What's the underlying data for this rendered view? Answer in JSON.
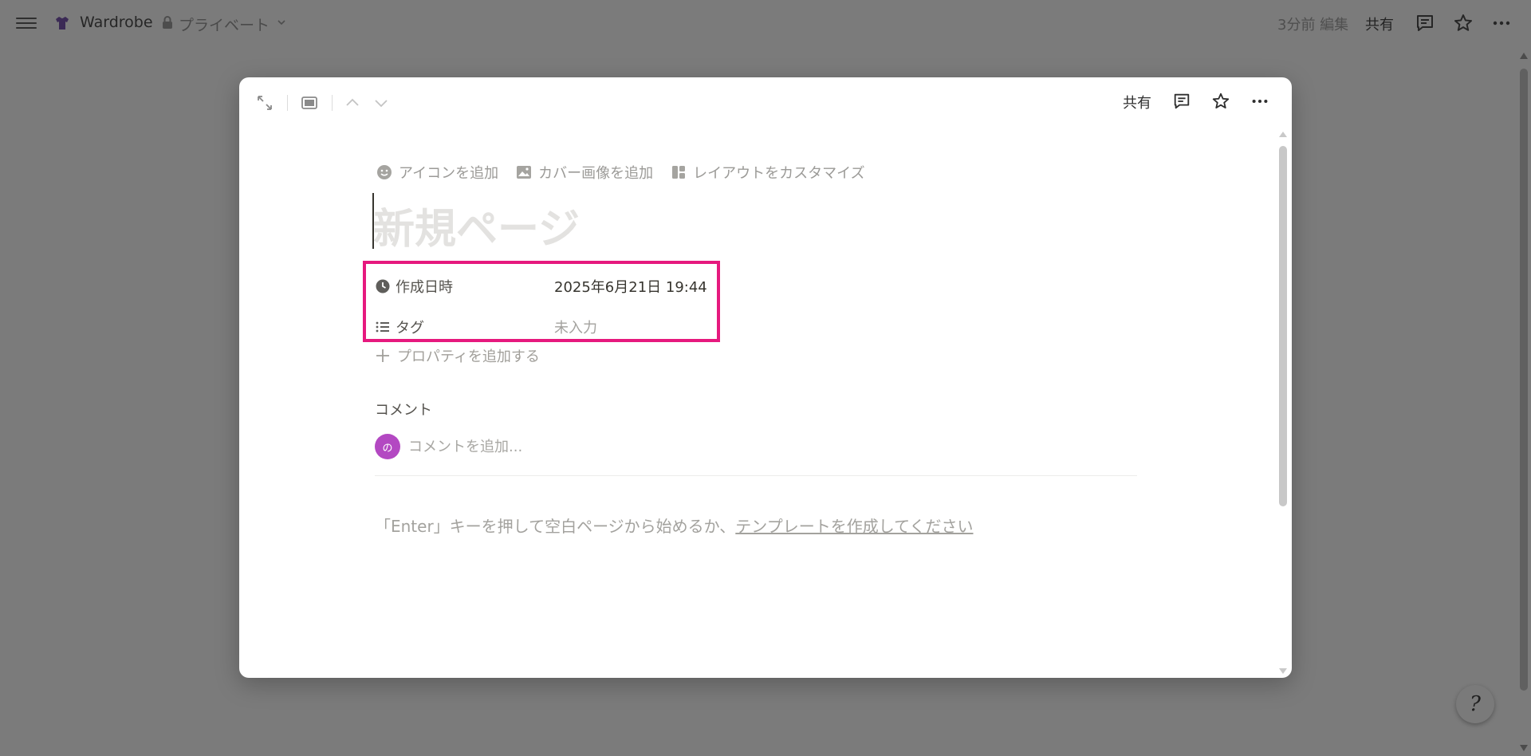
{
  "topbar": {
    "workspace_name": "Wardrobe",
    "privacy_label": "プライベート",
    "edited_label": "3分前 編集",
    "share_label": "共有"
  },
  "modal": {
    "share_label": "共有",
    "page_actions": {
      "add_icon": "アイコンを追加",
      "add_cover": "カバー画像を追加",
      "customize_layout": "レイアウトをカスタマイズ"
    },
    "title_placeholder": "新規ページ",
    "properties": [
      {
        "icon": "clock-icon",
        "label": "作成日時",
        "value": "2025年6月21日 19:44",
        "empty": false
      },
      {
        "icon": "list-icon",
        "label": "タグ",
        "value": "未入力",
        "empty": true
      }
    ],
    "add_property_label": "プロパティを追加する",
    "comments": {
      "heading": "コメント",
      "avatar_initial": "の",
      "placeholder": "コメントを追加..."
    },
    "empty_hint": {
      "text": "「Enter」キーを押して空白ページから始めるか、",
      "link": "テンプレートを作成してください"
    }
  },
  "help_button": {
    "glyph": "?"
  },
  "colors": {
    "highlight": "#e6197e",
    "avatar": "#b348c2",
    "overlay": "#7b7b7b"
  }
}
